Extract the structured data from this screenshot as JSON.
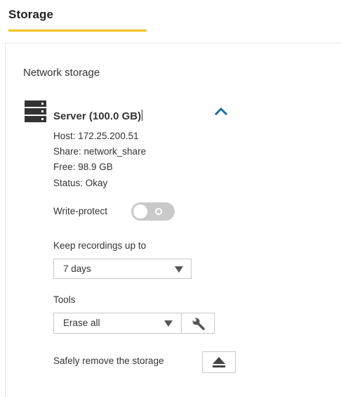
{
  "header": {
    "title": "Storage"
  },
  "section": {
    "title": "Network storage"
  },
  "server": {
    "name": "Server (100.0 GB)",
    "icon": "server-stack-icon",
    "expand_icon": "chevron-up-icon",
    "host": "Host: 172.25.200.51",
    "share": "Share: network_share",
    "free": "Free: 98.9 GB",
    "status": "Status: Okay"
  },
  "write_protect": {
    "label": "Write-protect",
    "enabled": false
  },
  "keep_recordings": {
    "label": "Keep recordings up to",
    "value": "7 days"
  },
  "tools": {
    "label": "Tools",
    "value": "Erase all",
    "action_icon": "wrench-icon"
  },
  "remove": {
    "label": "Safely remove the storage",
    "icon": "eject-icon"
  },
  "colors": {
    "accent": "#f3c31f",
    "chevron": "#1a6fa3",
    "toggle_off": "#c9c9c9",
    "text": "#333333"
  }
}
